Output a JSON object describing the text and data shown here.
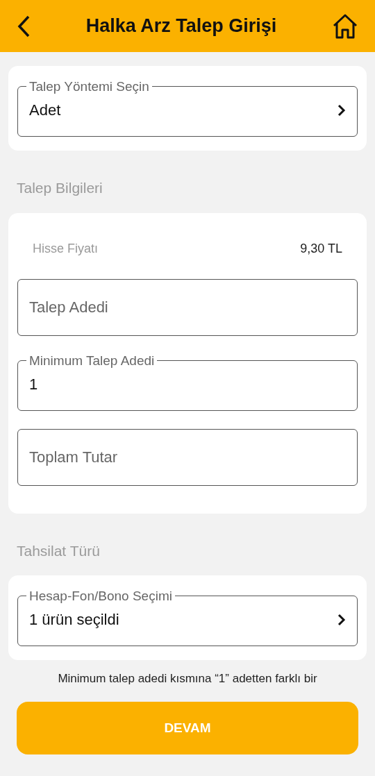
{
  "header": {
    "title": "Halka Arz Talep Girişi"
  },
  "method_card": {
    "fields": [
      {
        "kind": "select",
        "label": "Talep Yöntemi Seçin",
        "value": "Adet"
      }
    ]
  },
  "request_section": {
    "title": "Talep Bilgileri"
  },
  "request_card": {
    "price_label": "Hisse Fiyatı",
    "price_value": "9,30 TL",
    "fields": [
      {
        "kind": "input",
        "placeholder": "Talep Adedi"
      },
      {
        "kind": "input",
        "label": "Minimum Talep Adedi",
        "value": "1"
      },
      {
        "kind": "input",
        "placeholder": "Toplam Tutar"
      }
    ]
  },
  "collection_section": {
    "title": "Tahsilat Türü"
  },
  "collection_card": {
    "fields": [
      {
        "kind": "select",
        "label": "Hesap-Fon/Bono Seçimi",
        "value": "1 ürün seçildi"
      }
    ]
  },
  "note": "Minimum talep adedi kısmına “1” adetten farklı bir",
  "continue_button": "DEVAM"
}
